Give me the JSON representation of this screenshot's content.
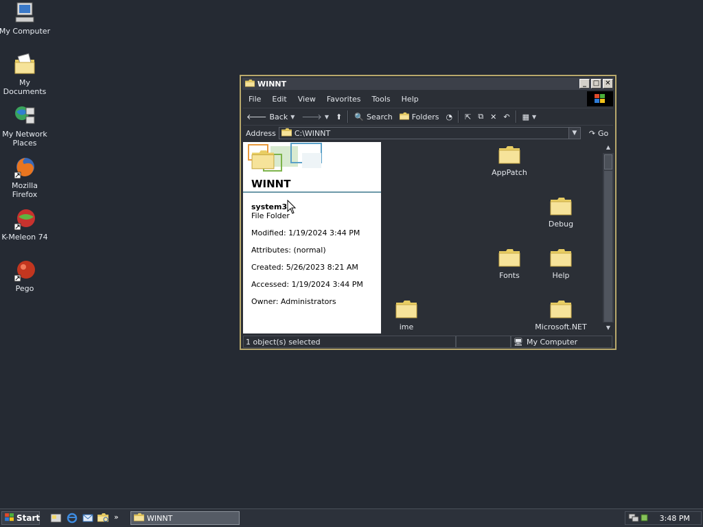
{
  "desktop": {
    "icons": [
      {
        "label": "My Computer",
        "icon": "my-computer-icon"
      },
      {
        "label": "My Documents",
        "icon": "my-documents-icon"
      },
      {
        "label": "My Network Places",
        "icon": "network-places-icon"
      },
      {
        "label": "Mozilla Firefox",
        "icon": "firefox-icon"
      },
      {
        "label": "K-Meleon 74",
        "icon": "kmeleon-icon"
      },
      {
        "label": "Pego",
        "icon": "pego-icon"
      }
    ]
  },
  "window": {
    "title": "WINNT",
    "menu": [
      "File",
      "Edit",
      "View",
      "Favorites",
      "Tools",
      "Help"
    ],
    "toolbar": {
      "back": "Back",
      "search": "Search",
      "folders": "Folders"
    },
    "address": {
      "label": "Address",
      "value": "C:\\WINNT",
      "go": "Go"
    },
    "details": {
      "folder_title": "WINNT",
      "selected_name": "system32",
      "type": "File Folder",
      "modified": "Modified: 1/19/2024 3:44 PM",
      "attributes": "Attributes: (normal)",
      "created": "Created: 5/26/2023 8:21 AM",
      "accessed": "Accessed: 1/19/2024 3:44 PM",
      "owner": "Owner: Administrators"
    },
    "files": [
      {
        "name": "AppPatch"
      },
      {
        "name": "Debug"
      },
      {
        "name": "Fonts"
      },
      {
        "name": "Help"
      },
      {
        "name": "ime"
      },
      {
        "name": "Microsoft.NET"
      }
    ],
    "status": {
      "selection": "1 object(s) selected",
      "zone": "My Computer"
    }
  },
  "taskbar": {
    "start": "Start",
    "task": "WINNT",
    "clock": "3:48 PM"
  },
  "colors": {
    "desktop": "#252a33",
    "window_border": "#b9a96c",
    "folder": "#f3df86"
  }
}
